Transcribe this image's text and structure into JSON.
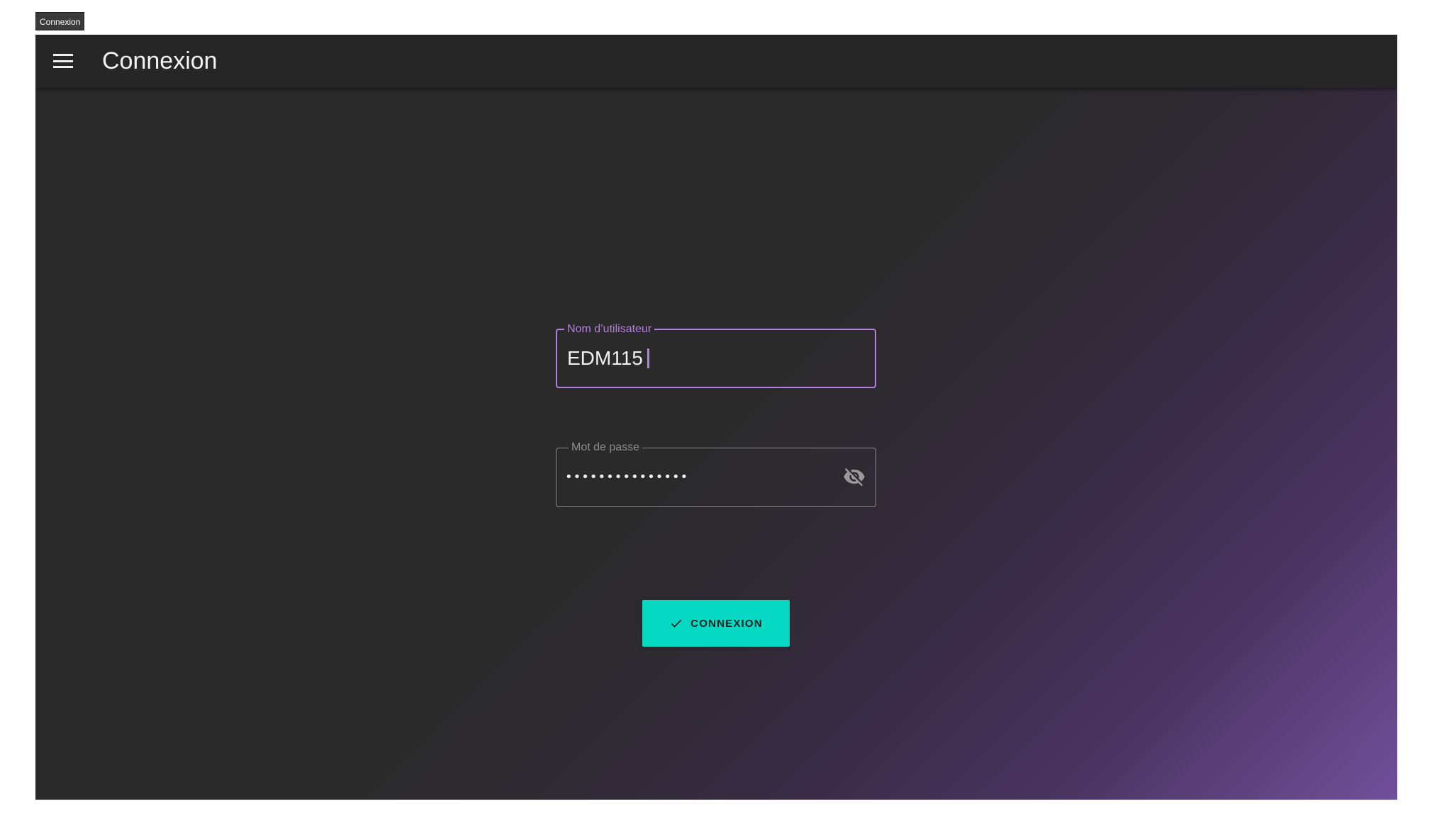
{
  "tooltip": {
    "text": "Connexion"
  },
  "appbar": {
    "menu_icon": "hamburger-menu-icon",
    "title": "Connexion"
  },
  "login_form": {
    "username": {
      "label": "Nom d’utilisateur",
      "value": "EDM115",
      "focused": true
    },
    "password": {
      "label": "Mot de passe",
      "masked_value": "•••••••••••••••",
      "visibility_icon": "eye-off-icon"
    },
    "submit": {
      "icon": "check-icon",
      "label": "CONNEXION"
    }
  },
  "colors": {
    "accent_focus": "#b47fe0",
    "button": "#05d9c4",
    "appbar": "#262626",
    "background": "#2a2a2a",
    "gradient_end": "#71509a"
  }
}
